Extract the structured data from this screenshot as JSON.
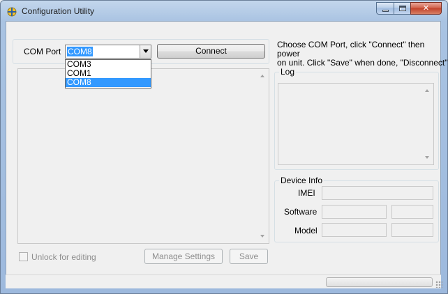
{
  "window": {
    "title": "Configuration Utility"
  },
  "com": {
    "label": "COM Port",
    "selected": "COM8",
    "options": [
      "COM3",
      "COM1",
      "COM8"
    ],
    "connect_label": "Connect"
  },
  "instructions": {
    "line1": "Choose COM Port, click \"Connect\" then power",
    "line2": "on unit.  Click \"Save\" when done, \"Disconnect\""
  },
  "log": {
    "label": "Log"
  },
  "device_info": {
    "label": "Device Info",
    "imei_label": "IMEI",
    "software_label": "Software",
    "model_label": "Model"
  },
  "footer": {
    "unlock_label": "Unlock for editing",
    "manage_label": "Manage Settings",
    "save_label": "Save"
  },
  "colors": {
    "selection": "#3399ff",
    "close_button": "#c2432c"
  }
}
